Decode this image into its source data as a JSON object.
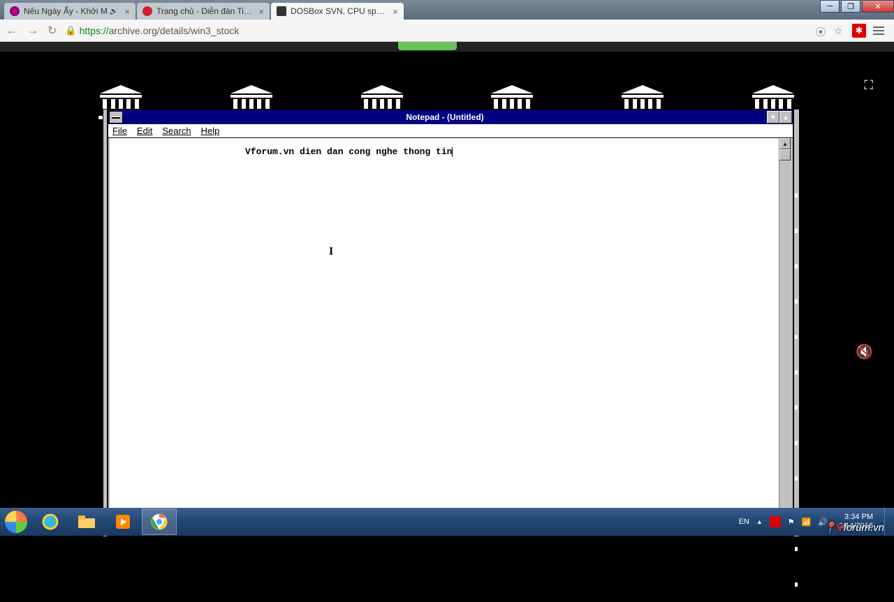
{
  "browser": {
    "tabs": [
      {
        "title": "Nếu Ngày Ấy - Khởi M",
        "active": false,
        "icon_color": "radial-gradient(circle,#f06,#309)"
      },
      {
        "title": "Trang chủ - Diễn đàn Tin h",
        "active": false,
        "icon_color": "#d02030"
      },
      {
        "title": "DOSBox SVN, CPU speed:",
        "active": true,
        "icon_color": "#333"
      }
    ],
    "url_proto": "https://",
    "url_rest": "archive.org/details/win3_stock",
    "window_controls": {
      "min": "–",
      "max": "❐",
      "close": "✕"
    }
  },
  "emu": {
    "fullscreen_icon": "⤢",
    "mute_icon": "🔇"
  },
  "notepad": {
    "title": "Notepad - (Untitled)",
    "menu": {
      "file": "File",
      "edit": "Edit",
      "search": "Search",
      "help": "Help"
    },
    "content": "Vforum.vn dien dan cong nghe thong tin"
  },
  "taskbar": {
    "lang": "EN",
    "time": "3:34 PM",
    "date": "2/14/2016",
    "tray_up": "▲"
  },
  "watermark_prefix": "V",
  "watermark_rest": "forum.vn"
}
